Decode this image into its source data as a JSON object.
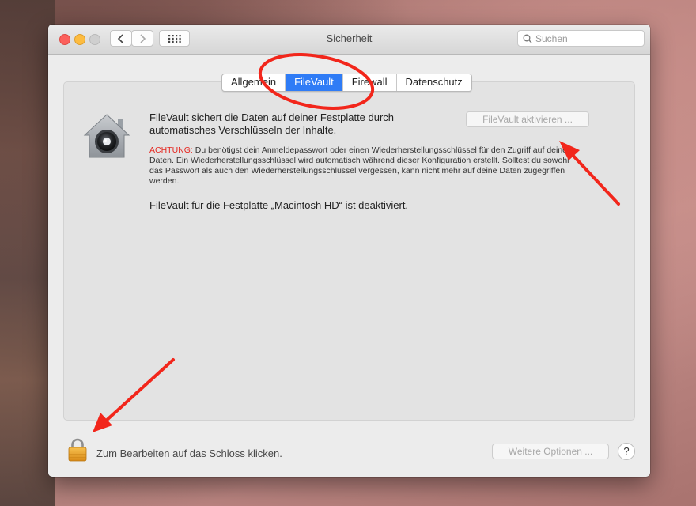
{
  "window": {
    "title": "Sicherheit",
    "search_placeholder": "Suchen"
  },
  "tabs": [
    {
      "label": "Allgemein",
      "active": false
    },
    {
      "label": "FileVault",
      "active": true
    },
    {
      "label": "Firewall",
      "active": false
    },
    {
      "label": "Datenschutz",
      "active": false
    }
  ],
  "filevault": {
    "description": "FileVault sichert die Daten auf deiner Festplatte durch automatisches Verschlüsseln der Inhalte.",
    "enable_button": "FileVault aktivieren ...",
    "warning_prefix": "ACHTUNG:",
    "warning_text": " Du benötigst dein Anmeldepasswort oder einen Wiederherstellungsschlüssel für den Zugriff auf deine Daten. Ein Wiederherstellungsschlüssel wird automatisch während dieser Konfiguration erstellt. Solltest du sowohl das Passwort als auch den Wiederherstellungsschlüssel vergessen, kann nicht mehr auf deine Daten zugegriffen werden.",
    "status": "FileVault für die Festplatte „Macintosh HD“ ist deaktiviert."
  },
  "footer": {
    "lock_text": "Zum Bearbeiten auf das Schloss klicken.",
    "advanced_button": "Weitere Optionen ...",
    "help_label": "?"
  },
  "colors": {
    "accent": "#2f7cf6",
    "warning": "#e5261f",
    "annotation": "#f2261b"
  },
  "icons": [
    "back-icon",
    "forward-icon",
    "grid-icon",
    "search-icon",
    "filevault-house-icon",
    "lock-icon"
  ]
}
